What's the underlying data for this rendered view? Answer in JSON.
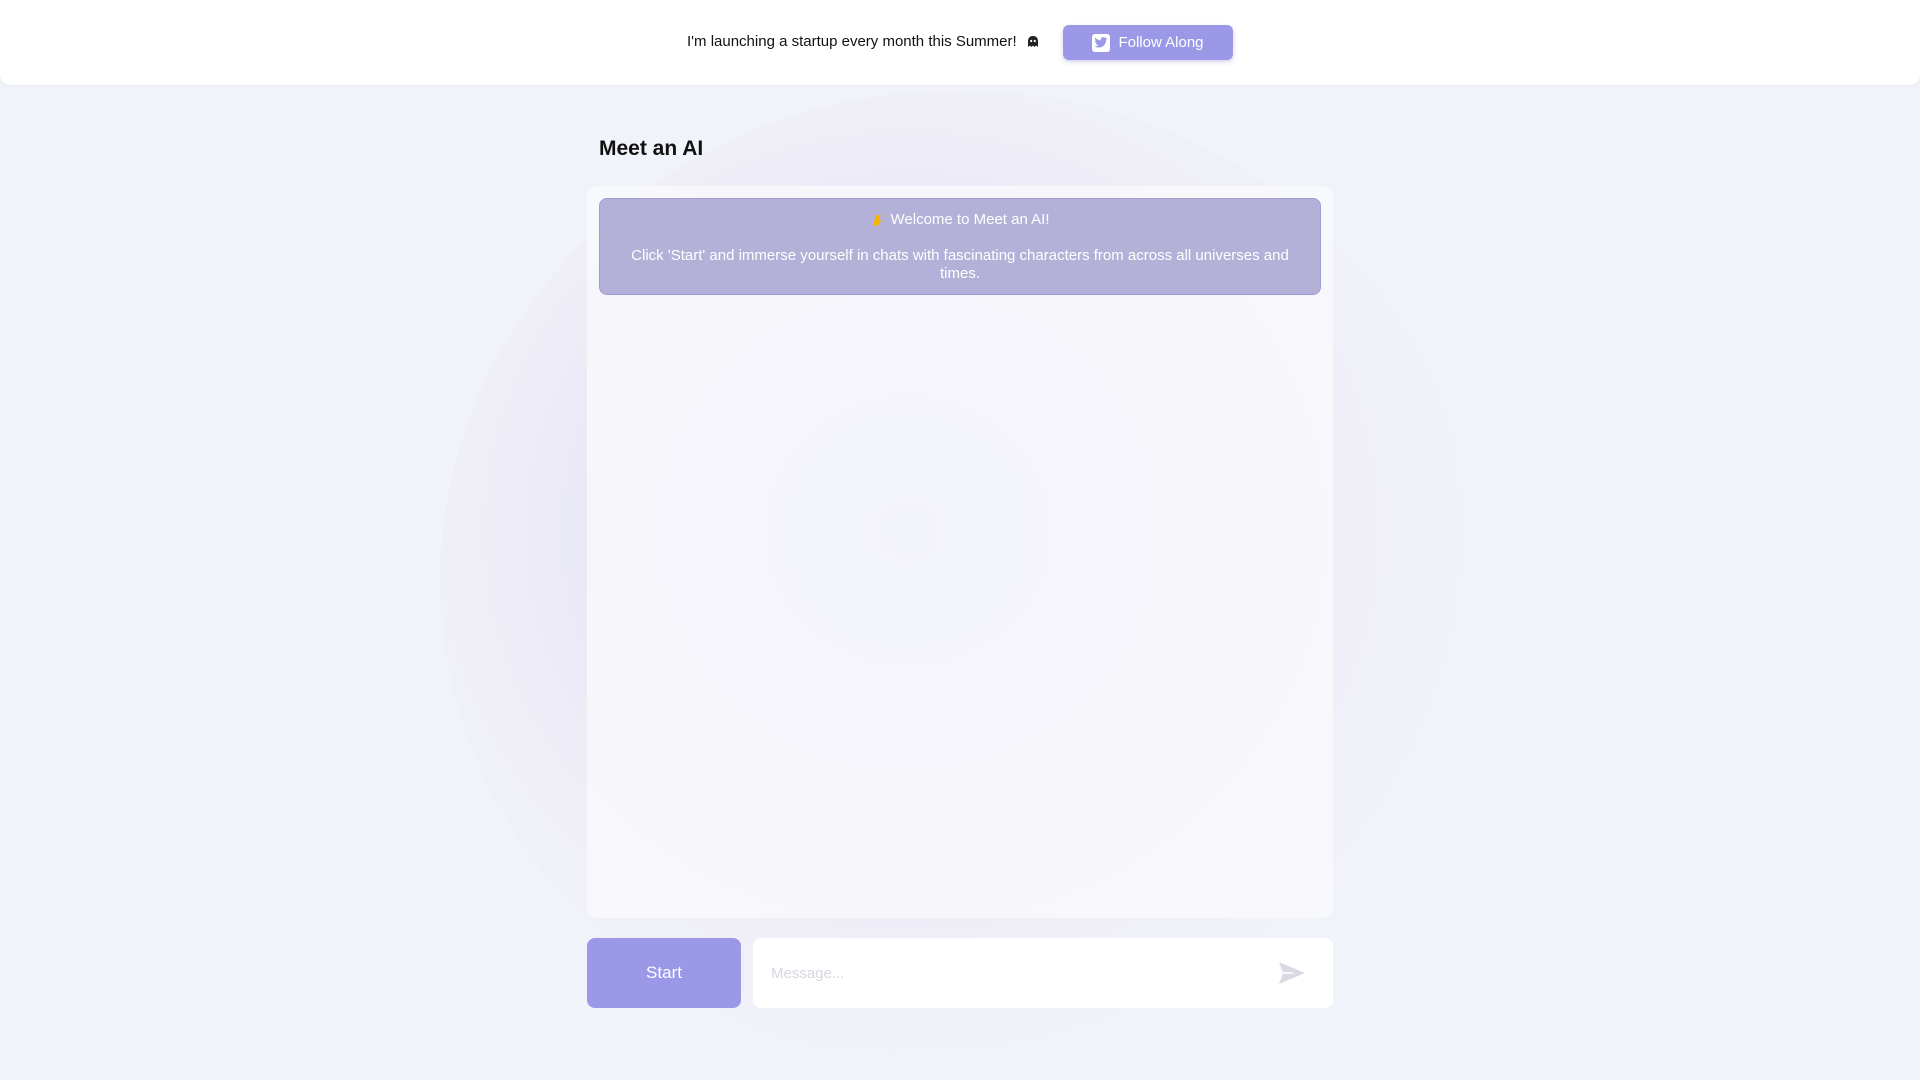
{
  "header": {
    "announcement": "I'm launching a startup every month this Summer!",
    "follow_label": "Follow Along"
  },
  "page": {
    "title": "Meet an AI"
  },
  "welcome": {
    "title": "Welcome to Meet an AI!",
    "body": "Click 'Start' and immerse yourself in chats with fascinating characters from across all universes and times."
  },
  "controls": {
    "start_label": "Start",
    "message_placeholder": "Message..."
  },
  "colors": {
    "accent": "#9b98e8",
    "welcome_bg": "#b4b1d9",
    "background": "#f1f3fa"
  },
  "icons": {
    "announcement_icon": "ghost-icon",
    "follow_icon": "twitter-icon",
    "welcome_icon": "waving-hand-icon",
    "send_icon": "send-icon"
  }
}
